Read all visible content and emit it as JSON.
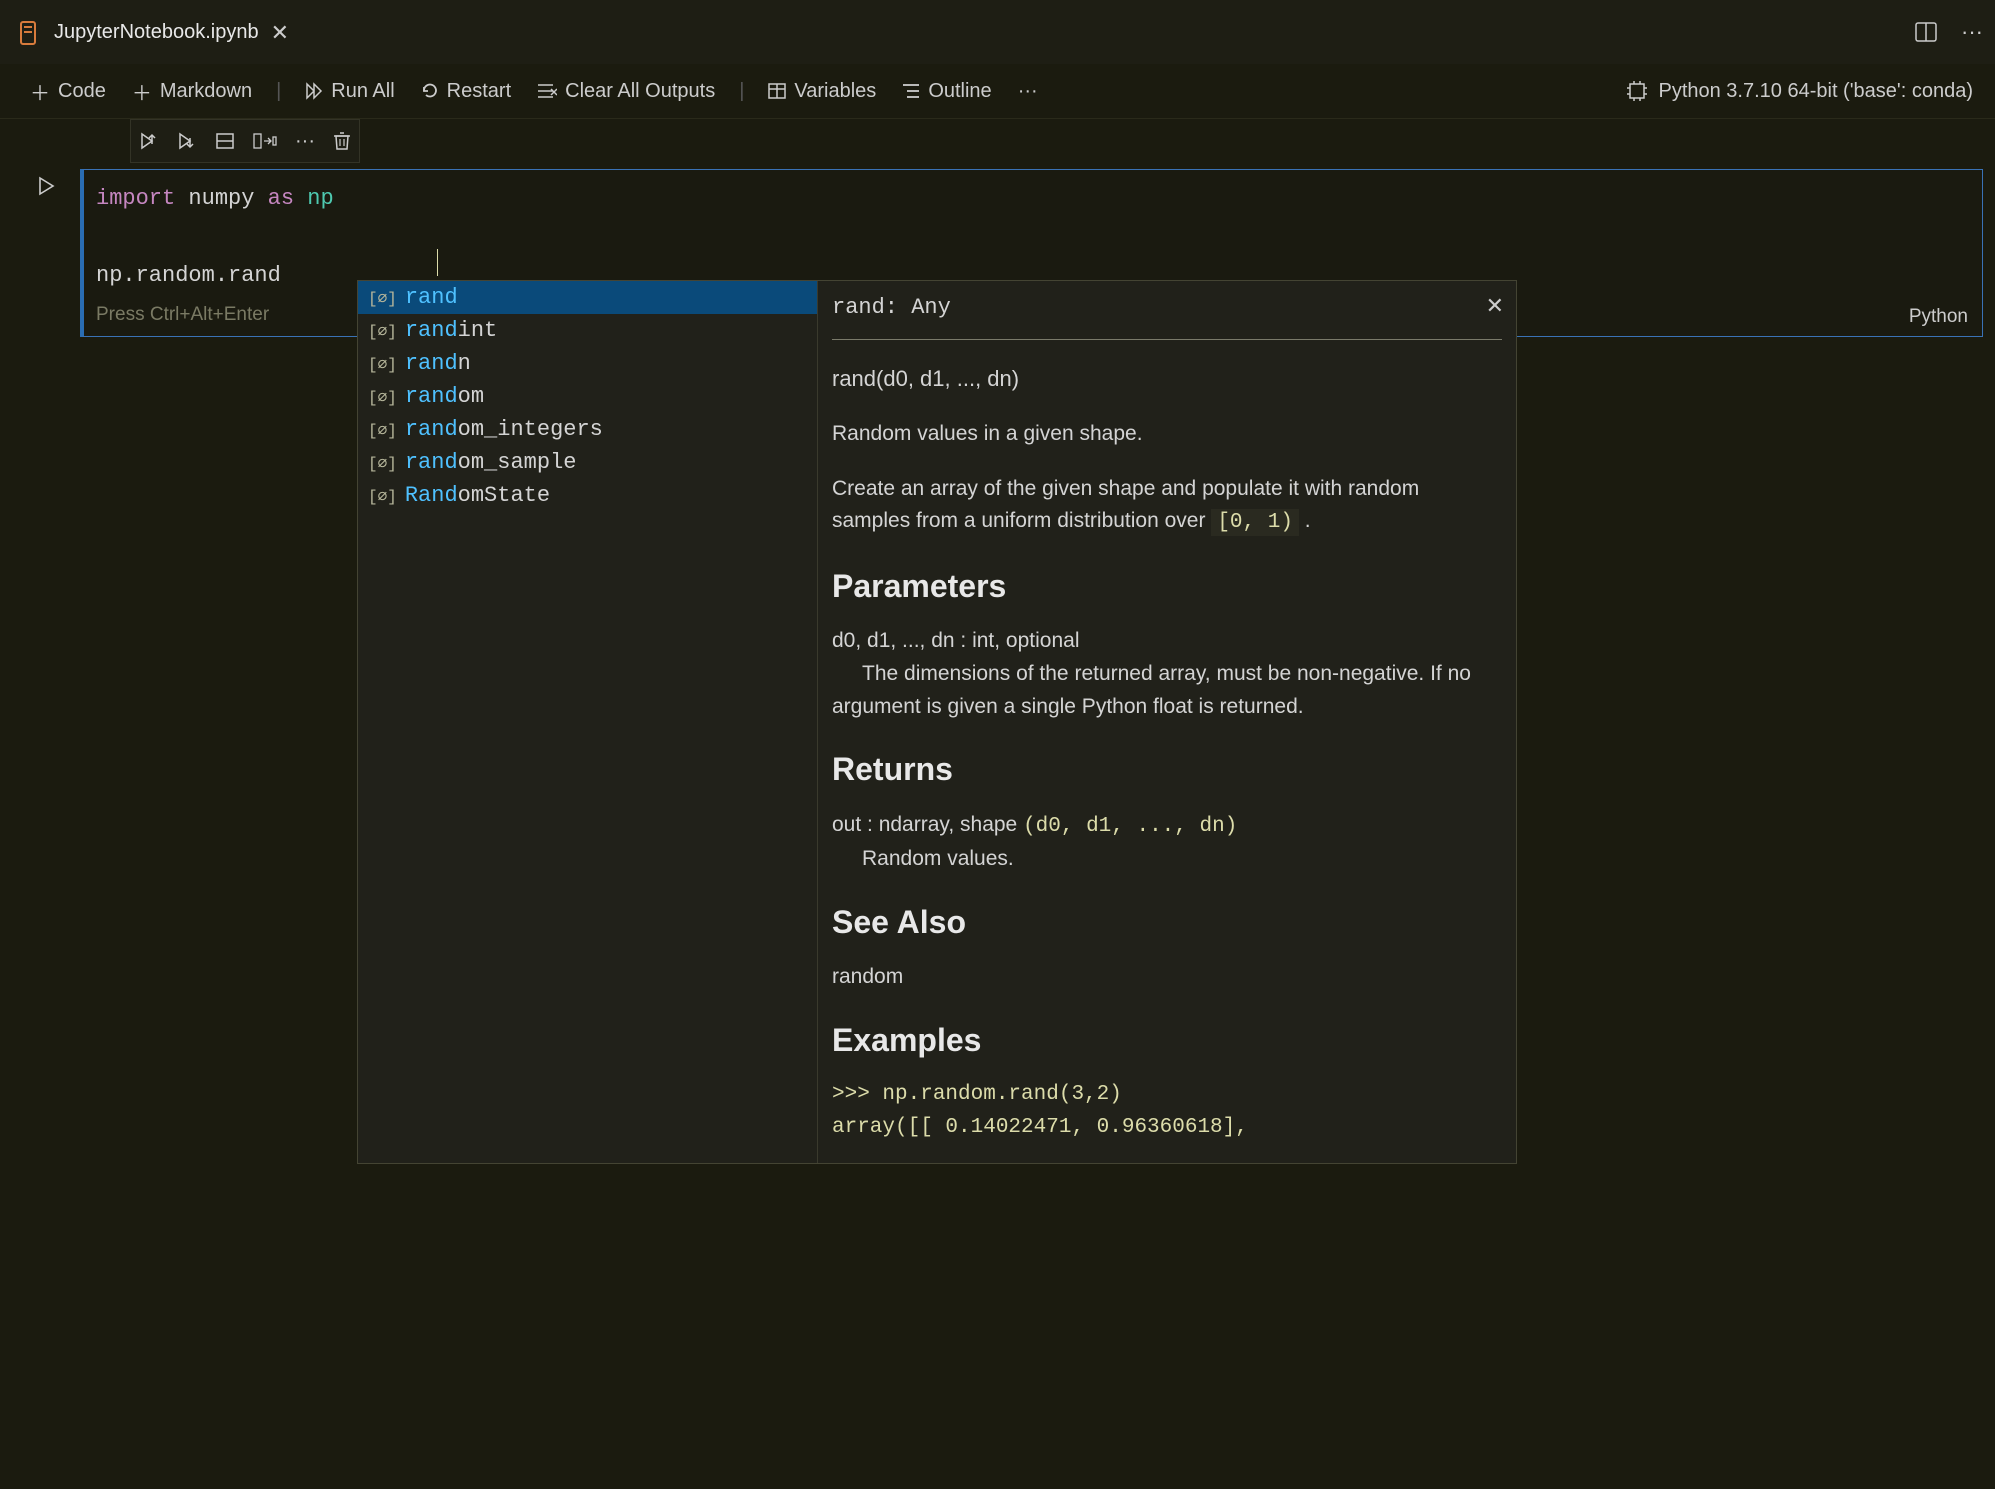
{
  "tab": {
    "title": "JupyterNotebook.ipynb",
    "file_icon_color": "#d87b3c"
  },
  "toolbar": {
    "code": "Code",
    "markdown": "Markdown",
    "run_all": "Run All",
    "restart": "Restart",
    "clear_outputs": "Clear All Outputs",
    "variables": "Variables",
    "outline": "Outline"
  },
  "kernel": {
    "label": "Python 3.7.10 64-bit ('base': conda)"
  },
  "cell": {
    "language": "Python",
    "hint": "Press Ctrl+Alt+Enter",
    "code": {
      "line1_kw": "import",
      "line1_mod": " numpy ",
      "line1_as": "as",
      "line1_alias": " np",
      "line2": "np.random.rand"
    }
  },
  "suggest": {
    "items": [
      {
        "match": "rand",
        "rest": ""
      },
      {
        "match": "rand",
        "rest": "int"
      },
      {
        "match": "rand",
        "rest": "n"
      },
      {
        "match": "rand",
        "rest": "om"
      },
      {
        "match": "rand",
        "rest": "om_integers"
      },
      {
        "match": "rand",
        "rest": "om_sample"
      },
      {
        "match": "Rand",
        "rest": "omState"
      }
    ]
  },
  "doc": {
    "header": "rand: Any",
    "signature": "rand(d0, d1, ..., dn)",
    "summary": "Random values in a given shape.",
    "desc_pre": "Create an array of the given shape and populate it with random samples from a uniform distribution over ",
    "desc_code": "[0, 1)",
    "desc_post": " .",
    "h_params": "Parameters",
    "param_line1": "d0, d1, ..., dn : int, optional",
    "param_line2": "The dimensions of the returned array, must be non-negative. If no argument is given a single Python float is returned.",
    "h_returns": "Returns",
    "ret_line1_pre": "out : ndarray, shape ",
    "ret_line1_code": "(d0, d1, ..., dn)",
    "ret_line2": "Random values.",
    "h_seealso": "See Also",
    "seealso": "random",
    "h_examples": "Examples",
    "example_l1": ">>> np.random.rand(3,2)",
    "example_l2": "array([[ 0.14022471,  0.96360618],"
  }
}
